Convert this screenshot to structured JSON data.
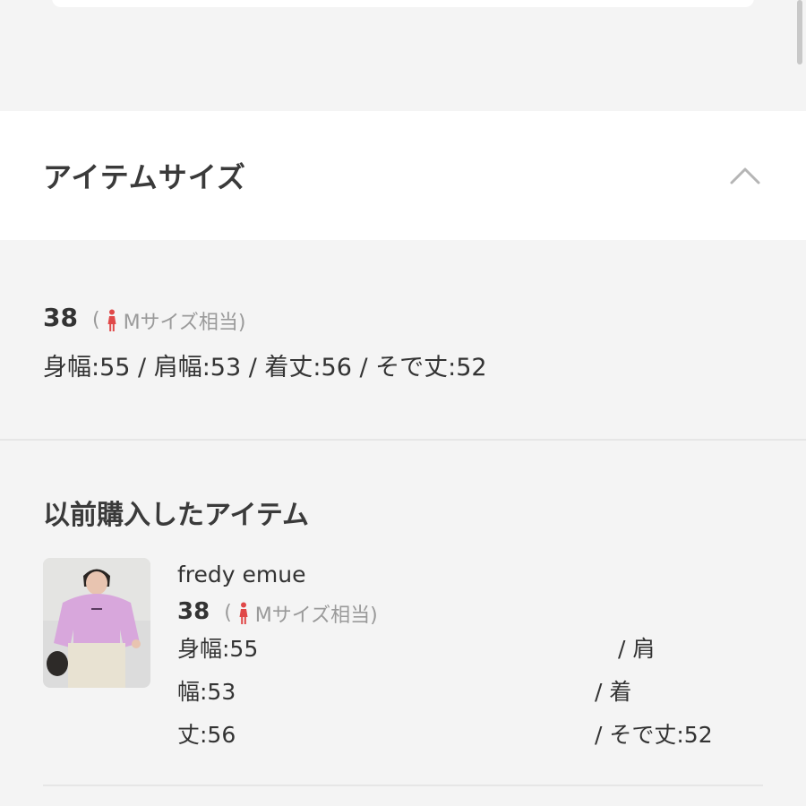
{
  "section": {
    "title": "アイテムサイズ"
  },
  "current_size": {
    "size": "38",
    "note_open": "(",
    "note_text": "Mサイズ相当)",
    "measurements": "身幅:55 / 肩幅:53 / 着丈:56 / そで丈:52"
  },
  "previous": {
    "title": "以前購入したアイテム",
    "items": [
      {
        "brand": "fredy emue",
        "size": "38",
        "note_open": "(",
        "note_text": "Mサイズ相当)",
        "rows": [
          {
            "left": "身幅:55",
            "right": "/ 肩"
          },
          {
            "left": "幅:53",
            "right": "/ 着"
          },
          {
            "left": "丈:56",
            "right": "/ そで丈:52"
          }
        ]
      }
    ]
  },
  "colors": {
    "accent_red": "#e04848",
    "header_bg": "#ffffff",
    "page_bg": "#f4f4f4"
  },
  "icons": [
    "chevron-up-icon",
    "female-icon"
  ]
}
